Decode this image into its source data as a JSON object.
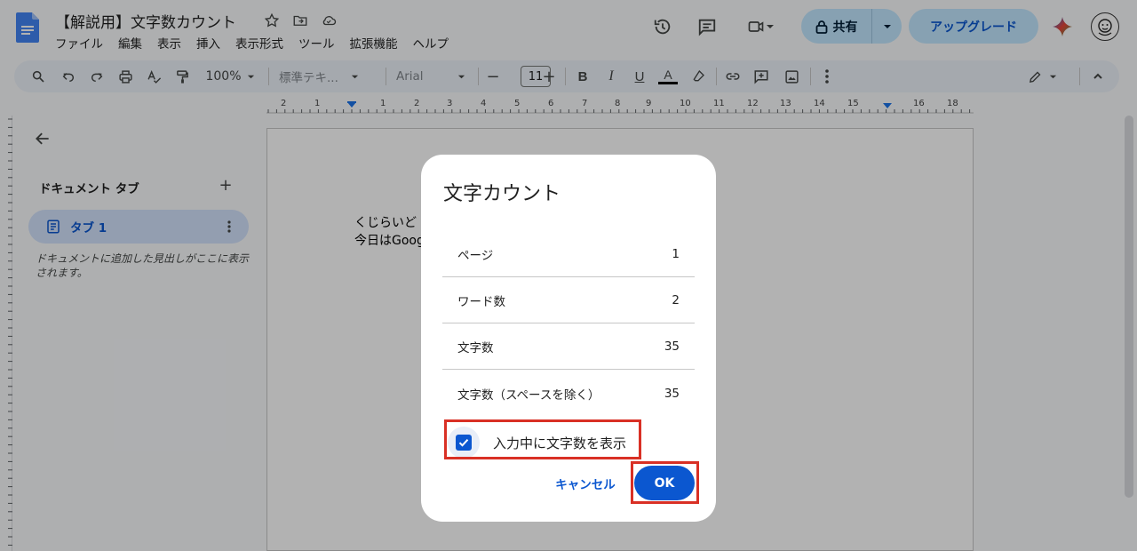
{
  "header": {
    "doc_title": "【解説用】文字数カウント",
    "menus": [
      "ファイル",
      "編集",
      "表示",
      "挿入",
      "表示形式",
      "ツール",
      "拡張機能",
      "ヘルプ"
    ],
    "share_label": "共有",
    "upgrade_label": "アップグレード"
  },
  "toolbar": {
    "zoom": "100%",
    "style": "標準テキ...",
    "font": "Arial",
    "font_size": "11"
  },
  "ruler": {
    "labels": [
      "2",
      "1",
      "1",
      "2",
      "3",
      "4",
      "5",
      "6",
      "7",
      "8",
      "9",
      "10",
      "11",
      "12",
      "13",
      "14",
      "15",
      "16",
      "18"
    ]
  },
  "sidebar": {
    "heading": "ドキュメント タブ",
    "tab_label": "タブ 1",
    "hint": "ドキュメントに追加した見出しがここに表示されます。"
  },
  "document": {
    "line1": "くじらいど",
    "line2": "今日はGoog"
  },
  "dialog": {
    "title": "文字カウント",
    "stats": [
      {
        "label": "ページ",
        "value": "1"
      },
      {
        "label": "ワード数",
        "value": "2"
      },
      {
        "label": "文字数",
        "value": "35"
      },
      {
        "label": "文字数（スペースを除く）",
        "value": "35"
      }
    ],
    "checkbox_label": "入力中に文字数を表示",
    "checkbox_checked": true,
    "cancel_label": "キャンセル",
    "ok_label": "OK"
  },
  "colors": {
    "accent": "#0b57d0",
    "highlight": "#d93025",
    "share_bg": "#c2e7ff"
  }
}
